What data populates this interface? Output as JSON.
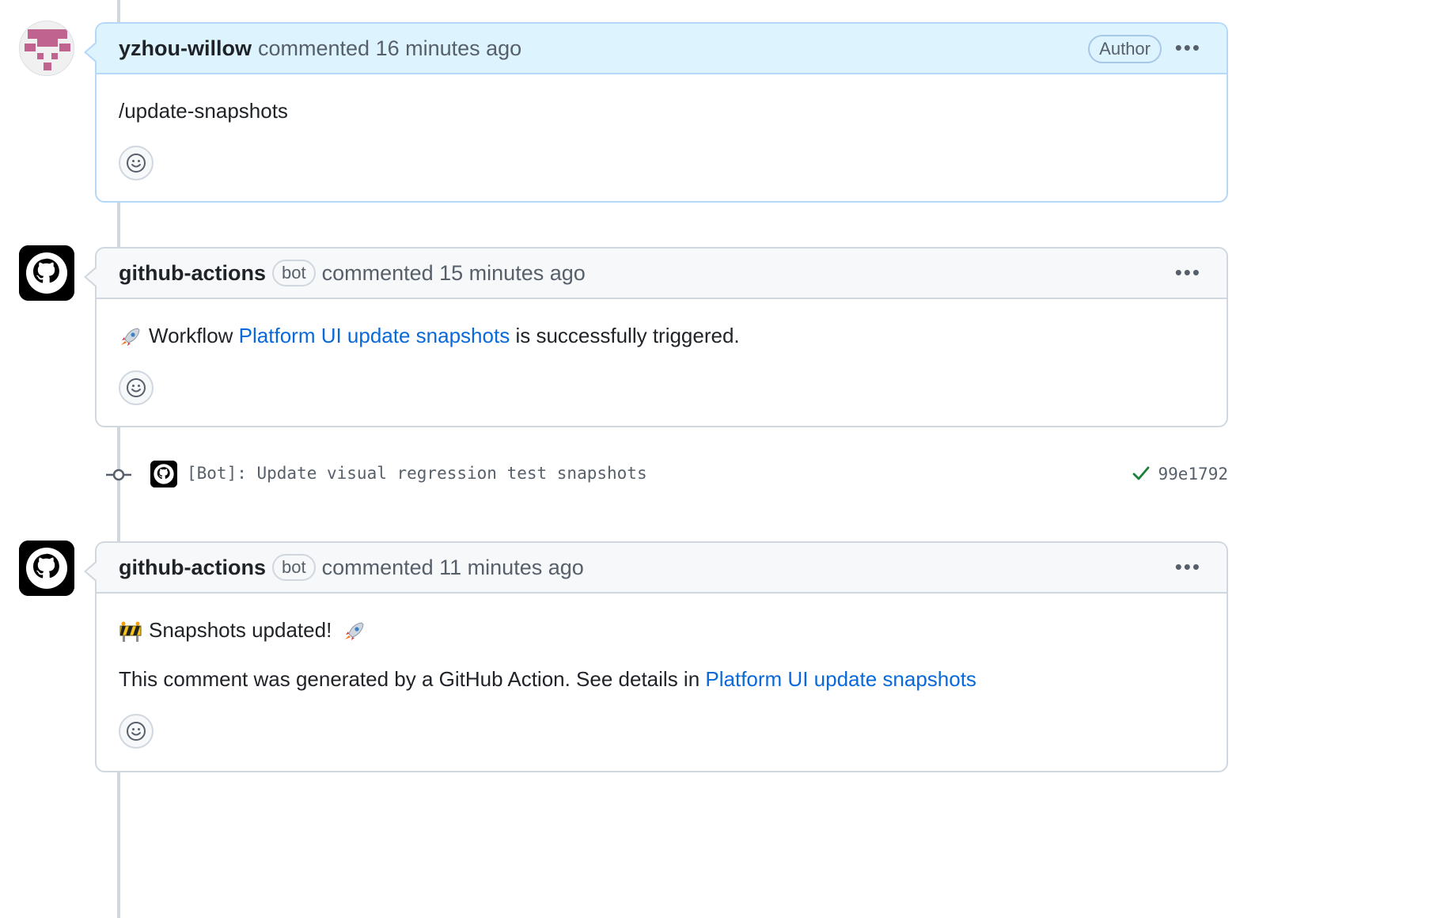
{
  "comments": [
    {
      "author": "yzhou-willow",
      "meta": "commented 16 minutes ago",
      "author_badge": "Author",
      "body": "/update-snapshots"
    },
    {
      "author": "github-actions",
      "bot_badge": "bot",
      "meta": "commented 15 minutes ago",
      "body_prefix": "Workflow",
      "body_link": "Platform UI update snapshots",
      "body_suffix": "is successfully triggered.",
      "emoji": "rocket"
    },
    {
      "author": "github-actions",
      "bot_badge": "bot",
      "meta": "commented 11 minutes ago",
      "line1": "Snapshots updated!",
      "line1_emojis": [
        "construction",
        "rocket"
      ],
      "line2_prefix": "This comment was generated by a GitHub Action. See details in",
      "line2_link": "Platform UI update snapshots"
    }
  ],
  "commit": {
    "message": "[Bot]: Update visual regression test snapshots",
    "sha": "99e1792",
    "status": "success"
  },
  "menu_glyph": "•••",
  "colors": {
    "link": "#0969da",
    "success": "#1a7f37",
    "own_header": "#ddf4ff",
    "header": "#f6f8fa",
    "identicon": "#c0648f"
  },
  "icons": [
    "identicon-avatar",
    "github-octocat-icon",
    "smiley-icon",
    "kebab-icon",
    "commit-node-icon",
    "check-icon",
    "rocket-icon",
    "construction-icon"
  ]
}
